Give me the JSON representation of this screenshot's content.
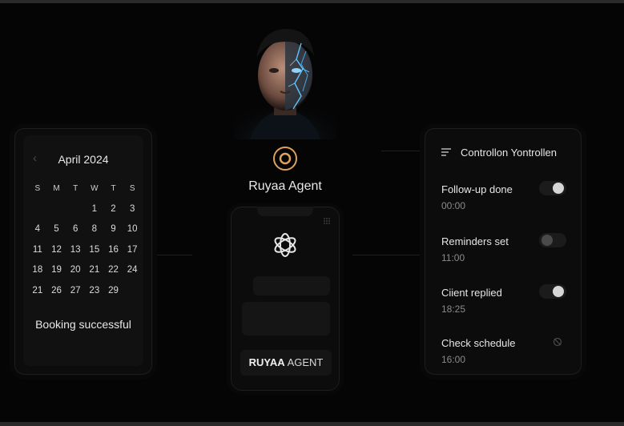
{
  "calendar": {
    "month_label": "April 2024",
    "prev_icon": "chevron-left-icon",
    "days_of_week": [
      "S",
      "M",
      "T",
      "W",
      "T",
      "S"
    ],
    "weeks": [
      [
        "",
        "",
        "",
        "1",
        "2",
        "3"
      ],
      [
        "4",
        "5",
        "6",
        "8",
        "9",
        "10"
      ],
      [
        "11",
        "12",
        "13",
        "15",
        "16",
        "17"
      ],
      [
        "18",
        "19",
        "20",
        "21",
        "22",
        "24"
      ],
      [
        "21",
        "26",
        "27",
        "23",
        "29",
        ""
      ]
    ],
    "status": "Booking successful"
  },
  "agent": {
    "name": "Ruyaa Agent",
    "icon": "ring-icon",
    "accent": "#e0a15a"
  },
  "phone": {
    "logo_icon": "openai-logo-icon",
    "button_bold": "RUYAA",
    "button_rest": " AGENT"
  },
  "control": {
    "title": "Controllon Yontrollen",
    "icon": "filter-lines-icon",
    "items": [
      {
        "label": "Follow-up done",
        "time": "00:00",
        "state": "on"
      },
      {
        "label": "Reminders set",
        "time": "11:00",
        "state": "off"
      },
      {
        "label": "Ciient replied",
        "time": "18:25",
        "state": "on"
      },
      {
        "label": "Check schedule",
        "time": "16:00",
        "state": "pending"
      }
    ]
  }
}
